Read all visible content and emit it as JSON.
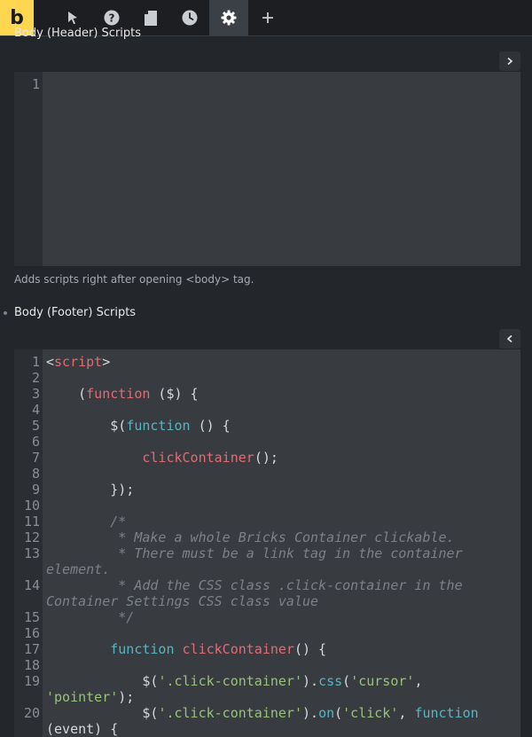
{
  "toolbar": {
    "logo": "b",
    "buttons": [
      {
        "icon": "cursor-icon"
      },
      {
        "icon": "help-icon"
      },
      {
        "icon": "page-icon"
      },
      {
        "icon": "history-icon"
      },
      {
        "icon": "settings-icon",
        "active": true
      },
      {
        "icon": "plus-icon"
      }
    ]
  },
  "header_section": {
    "label": "Body (Header) Scripts",
    "line_numbers": [
      "1"
    ],
    "hint": "Adds scripts right after opening <body> tag."
  },
  "footer_section": {
    "label": "Body (Footer) Scripts",
    "code_lines": [
      {
        "n": "1",
        "tokens": [
          {
            "t": "<",
            "c": "plain"
          },
          {
            "t": "script",
            "c": "tag"
          },
          {
            "t": ">",
            "c": "plain"
          }
        ]
      },
      {
        "n": "2",
        "tokens": []
      },
      {
        "n": "3",
        "tokens": [
          {
            "t": "    (",
            "c": "plain"
          },
          {
            "t": "function",
            "c": "fn"
          },
          {
            "t": " ($) {",
            "c": "plain"
          }
        ]
      },
      {
        "n": "4",
        "tokens": []
      },
      {
        "n": "5",
        "tokens": [
          {
            "t": "        $(",
            "c": "plain"
          },
          {
            "t": "function",
            "c": "kw"
          },
          {
            "t": " () {",
            "c": "plain"
          }
        ]
      },
      {
        "n": "6",
        "tokens": []
      },
      {
        "n": "7",
        "tokens": [
          {
            "t": "            ",
            "c": "plain"
          },
          {
            "t": "clickContainer",
            "c": "fn"
          },
          {
            "t": "();",
            "c": "plain"
          }
        ]
      },
      {
        "n": "8",
        "tokens": []
      },
      {
        "n": "9",
        "tokens": [
          {
            "t": "        });",
            "c": "plain"
          }
        ]
      },
      {
        "n": "10",
        "tokens": []
      },
      {
        "n": "11",
        "tokens": [
          {
            "t": "        /*",
            "c": "cm"
          }
        ]
      },
      {
        "n": "12",
        "tokens": [
          {
            "t": "         * Make a whole Bricks Container clickable.",
            "c": "cm"
          }
        ]
      },
      {
        "n": "13",
        "tokens": [
          {
            "t": "         * There must be a link tag in the container",
            "c": "cm"
          }
        ],
        "wrap": [
          {
            "t": "element.",
            "c": "cm"
          }
        ]
      },
      {
        "n": "14",
        "tokens": [
          {
            "t": "         * Add the CSS class .click-container in the",
            "c": "cm"
          }
        ],
        "wrap": [
          {
            "t": "Container Settings CSS class value",
            "c": "cm"
          }
        ]
      },
      {
        "n": "15",
        "tokens": [
          {
            "t": "         */",
            "c": "cm"
          }
        ]
      },
      {
        "n": "16",
        "tokens": []
      },
      {
        "n": "17",
        "tokens": [
          {
            "t": "        ",
            "c": "plain"
          },
          {
            "t": "function",
            "c": "kw"
          },
          {
            "t": " ",
            "c": "plain"
          },
          {
            "t": "clickContainer",
            "c": "fn"
          },
          {
            "t": "() {",
            "c": "plain"
          }
        ]
      },
      {
        "n": "18",
        "tokens": []
      },
      {
        "n": "19",
        "tokens": [
          {
            "t": "            $(",
            "c": "plain"
          },
          {
            "t": "'.click-container'",
            "c": "str"
          },
          {
            "t": ").",
            "c": "plain"
          },
          {
            "t": "css",
            "c": "kw"
          },
          {
            "t": "(",
            "c": "plain"
          },
          {
            "t": "'cursor'",
            "c": "str"
          },
          {
            "t": ",",
            "c": "plain"
          }
        ],
        "wrap": [
          {
            "t": "'pointer'",
            "c": "str"
          },
          {
            "t": ");",
            "c": "plain"
          }
        ]
      },
      {
        "n": "20",
        "tokens": [
          {
            "t": "            $(",
            "c": "plain"
          },
          {
            "t": "'.click-container'",
            "c": "str"
          },
          {
            "t": ").",
            "c": "plain"
          },
          {
            "t": "on",
            "c": "kw"
          },
          {
            "t": "(",
            "c": "plain"
          },
          {
            "t": "'click'",
            "c": "str"
          },
          {
            "t": ", ",
            "c": "plain"
          },
          {
            "t": "function",
            "c": "kw"
          }
        ],
        "wrap": [
          {
            "t": "(event) {",
            "c": "plain"
          }
        ]
      }
    ]
  },
  "colors": {
    "logo_bg": "#ffd64f",
    "editor_bg": "#383b40",
    "tag": "#e06c75",
    "keyword": "#56b6c2",
    "string": "#98c379",
    "comment": "#7d8188"
  }
}
